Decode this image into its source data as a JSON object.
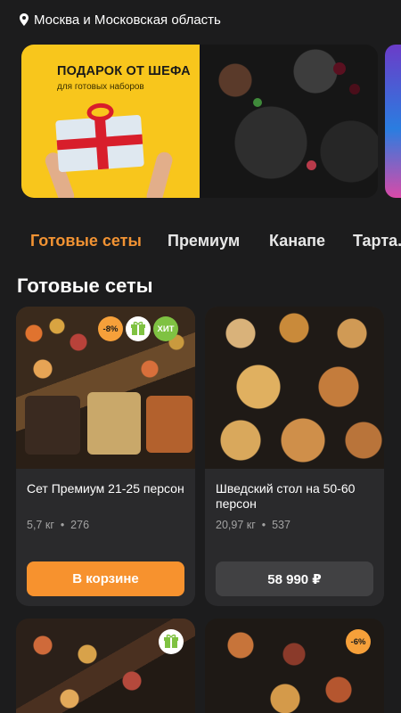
{
  "location": {
    "icon": "location-pin-icon",
    "text": "Москва и Московская область"
  },
  "banner": {
    "title": "ПОДАРОК ОТ ШЕФА",
    "subtitle": "для готовых наборов"
  },
  "tabs": [
    {
      "label": "Готовые сеты",
      "active": true
    },
    {
      "label": "Премиум",
      "active": false
    },
    {
      "label": "Канапе",
      "active": false
    },
    {
      "label": "Тарта...",
      "active": false
    }
  ],
  "section_title": "Готовые сеты",
  "products": [
    {
      "name": "Сет Премиум 21-25 персон",
      "weight": "5,7 кг",
      "count": "276",
      "badges": [
        "-8%",
        "gift-icon",
        "ХИТ"
      ],
      "button": "В корзине",
      "button_color": "#f7922e"
    },
    {
      "name": "Шведский стол на 50-60 персон",
      "weight": "20,97 кг",
      "count": "537",
      "badges": [],
      "button": "58 990 ₽",
      "button_color": "#414143"
    },
    {
      "name": "",
      "badges": [
        "gift-icon"
      ]
    },
    {
      "name": "",
      "badges": [
        "-6%"
      ]
    }
  ],
  "colors": {
    "accent": "#f7922e",
    "background": "#1c1c1d",
    "card": "#2a2a2c",
    "hit_green": "#7fc242"
  }
}
